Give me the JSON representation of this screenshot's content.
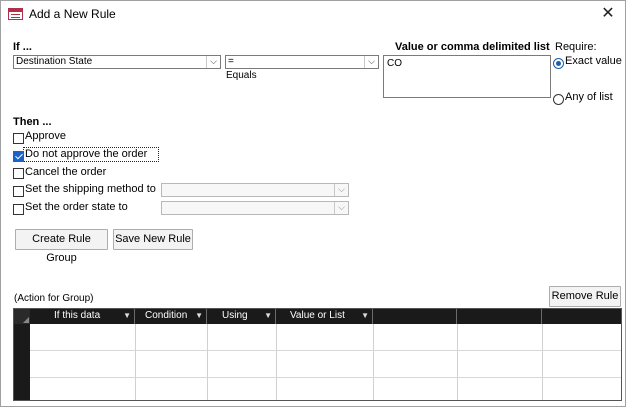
{
  "window": {
    "title": "Add a New Rule",
    "icon": "form-icon",
    "close_glyph": "✕"
  },
  "if_section": {
    "heading": "If ...",
    "field_combo": {
      "value": "Destination State"
    },
    "operator_combo": {
      "value": "=",
      "caption": "Equals"
    },
    "value_list": {
      "heading": "Value or comma delimited list",
      "value": "CO"
    },
    "require": {
      "heading": "Require:",
      "options": [
        {
          "label": "Exact value",
          "selected": true
        },
        {
          "label": "Any of list",
          "selected": false
        }
      ]
    }
  },
  "then_section": {
    "heading": "Then ...",
    "actions": [
      {
        "label": "Approve",
        "checked": false
      },
      {
        "label": "Do not approve the order",
        "checked": true
      },
      {
        "label": "Cancel the order",
        "checked": false
      },
      {
        "label": "Set the shipping method to",
        "checked": false,
        "combo_value": ""
      },
      {
        "label": "Set the order state to",
        "checked": false,
        "combo_value": ""
      }
    ]
  },
  "buttons": {
    "create_rule_group": "Create Rule Group",
    "save_new_rule": "Save New Rule",
    "remove_rule": "Remove Rule"
  },
  "group": {
    "caption": "(Action for Group)",
    "columns": [
      "If this data",
      "Condition",
      "Using",
      "Value or List",
      "",
      "",
      ""
    ],
    "rows": []
  },
  "colors": {
    "accent": "#1a64c8",
    "grid_header": "#1a1a1a"
  }
}
